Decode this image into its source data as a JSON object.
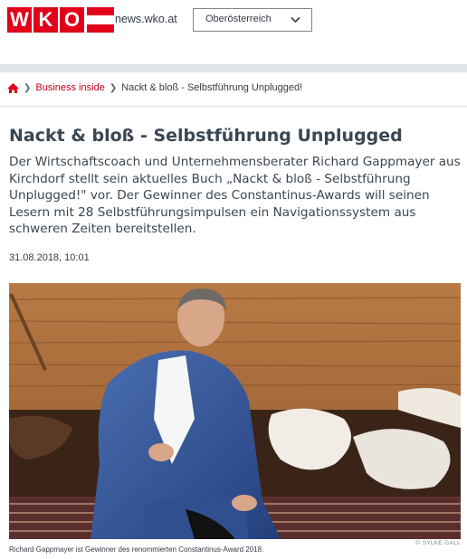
{
  "header": {
    "logo_letters": [
      "W",
      "K",
      "O"
    ],
    "logo_colors": {
      "red": "#e2001a",
      "white": "#ffffff"
    },
    "site": "news.wko.at",
    "region": {
      "value": "Oberösterreich",
      "icon": "chevron-down-icon"
    }
  },
  "breadcrumb": {
    "home_icon": "home-icon",
    "items": [
      {
        "label": "Business inside",
        "link": true
      },
      {
        "label": "Nackt & bloß - Selbstführung Unplugged!",
        "link": false
      }
    ]
  },
  "article": {
    "title": "Nackt & bloß - Selbstführung Unplugged",
    "lead": "Der Wirtschaftscoach und Unternehmensberater Richard Gappmayer aus Kirchdorf stellt sein aktuelles Buch „Nackt & bloß - Selbstführung Unplugged!\" vor. Der Gewinner des Constantinus-Awards will seinen Lesern mit 28 Selbstführungsimpulsen ein Navigationssystem aus schweren Zeiten bereitstellen.",
    "date": "31.08.2018, 10:01",
    "image_credit": "© SYLKE GALL",
    "image_caption": "Richard Gappmayer ist Gewinner des renommierten Constantinus-Award 2018."
  },
  "colors": {
    "brand_red": "#e2001a",
    "link_red": "#c3001a",
    "text": "#333c45",
    "band": "#dfe5e8"
  }
}
